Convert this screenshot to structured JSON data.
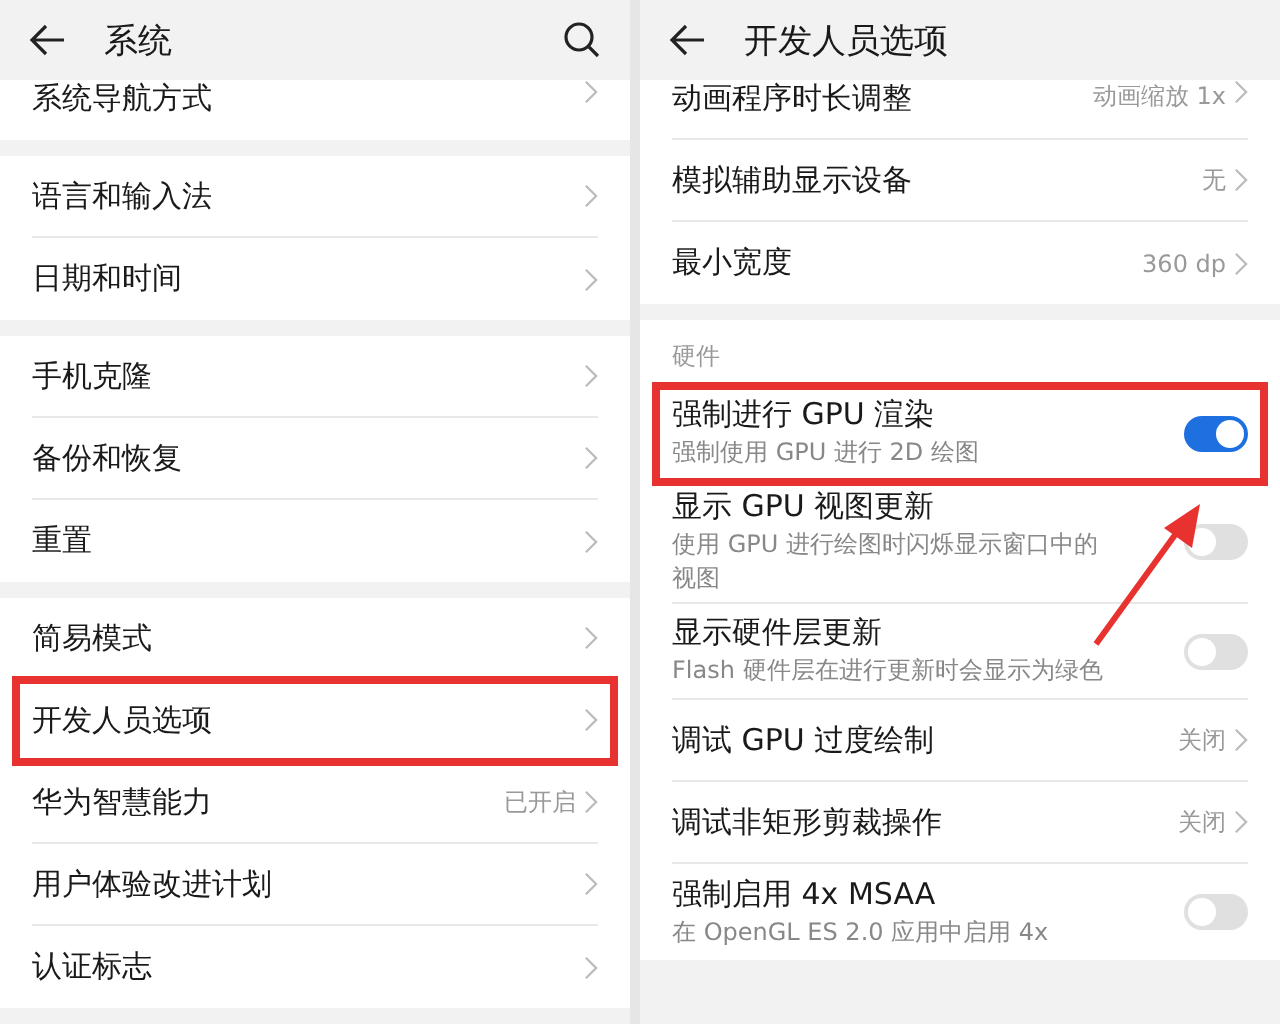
{
  "panels": [
    {
      "title": "系统",
      "search_button": true,
      "groups": [
        {
          "items": [
            {
              "kind": "link",
              "title": "系统导航方式",
              "highlighted": false
            }
          ]
        },
        {
          "items": [
            {
              "kind": "link",
              "title": "语言和输入法",
              "highlighted": false
            },
            {
              "kind": "link",
              "title": "日期和时间",
              "highlighted": false
            }
          ]
        },
        {
          "items": [
            {
              "kind": "link",
              "title": "手机克隆",
              "highlighted": false
            },
            {
              "kind": "link",
              "title": "备份和恢复",
              "highlighted": false
            },
            {
              "kind": "link",
              "title": "重置",
              "highlighted": false
            }
          ]
        },
        {
          "items": [
            {
              "kind": "link",
              "title": "简易模式",
              "highlighted": false
            },
            {
              "kind": "link",
              "title": "开发人员选项",
              "highlighted": true
            },
            {
              "kind": "link",
              "title": "华为智慧能力",
              "value": "已开启",
              "highlighted": false
            },
            {
              "kind": "link",
              "title": "用户体验改进计划",
              "highlighted": false
            },
            {
              "kind": "link",
              "title": "认证标志",
              "highlighted": false
            }
          ]
        }
      ]
    },
    {
      "title": "开发人员选项",
      "search_button": false,
      "groups": [
        {
          "items": [
            {
              "kind": "link",
              "title": "动画程序时长调整",
              "value": "动画缩放 1x",
              "highlighted": false
            },
            {
              "kind": "link",
              "title": "模拟辅助显示设备",
              "value": "无",
              "highlighted": false
            },
            {
              "kind": "link",
              "title": "最小宽度",
              "value": "360 dp",
              "highlighted": false
            }
          ]
        },
        {
          "header": "硬件",
          "items": [
            {
              "kind": "toggle",
              "title": "强制进行 GPU 渲染",
              "subtitle": "强制使用 GPU 进行 2D 绘图",
              "on": true,
              "highlighted": true
            },
            {
              "kind": "toggle",
              "title": "显示 GPU 视图更新",
              "subtitle": "使用 GPU 进行绘图时闪烁显示窗口中的视图",
              "on": false,
              "highlighted": false
            },
            {
              "kind": "toggle",
              "title": "显示硬件层更新",
              "subtitle": "Flash 硬件层在进行更新时会显示为绿色",
              "on": false,
              "highlighted": false
            },
            {
              "kind": "link",
              "title": "调试 GPU 过度绘制",
              "value": "关闭",
              "highlighted": false
            },
            {
              "kind": "link",
              "title": "调试非矩形剪裁操作",
              "value": "关闭",
              "highlighted": false
            },
            {
              "kind": "toggle",
              "title": "强制启用 4x MSAA",
              "subtitle": "在 OpenGL ES 2.0 应用中启用 4x",
              "on": false,
              "highlighted": false
            }
          ]
        }
      ]
    }
  ]
}
